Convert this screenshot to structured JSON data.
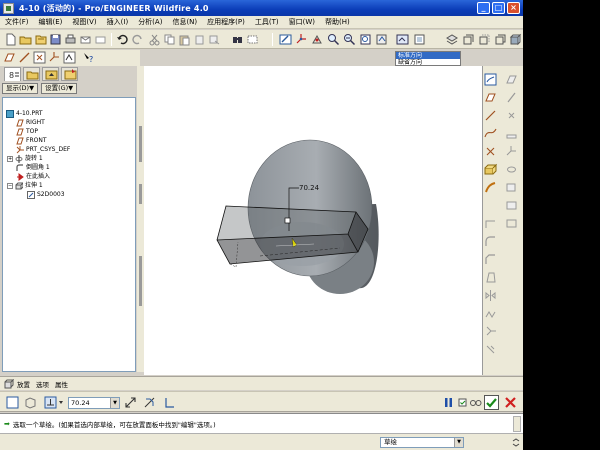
{
  "window": {
    "title": "4-10 (活动的) - Pro/ENGINEER Wildfire 4.0",
    "controls": [
      "_",
      "□",
      "×"
    ]
  },
  "menu": [
    "文件(F)",
    "编辑(E)",
    "视图(V)",
    "插入(I)",
    "分析(A)",
    "信息(N)",
    "应用程序(P)",
    "工具(T)",
    "窗口(W)",
    "帮助(H)"
  ],
  "view_dropdown": {
    "options": [
      "标准方向",
      "缺省方向"
    ],
    "selected": "标准方向"
  },
  "sidebar": {
    "display_btn": "显示(D)▼",
    "settings_btn": "设置(G)▼",
    "tree": [
      {
        "label": "4-10.PRT",
        "icon": "part-icon"
      },
      {
        "label": "RIGHT",
        "icon": "datum-plane-icon"
      },
      {
        "label": "TOP",
        "icon": "datum-plane-icon"
      },
      {
        "label": "FRONT",
        "icon": "datum-plane-icon"
      },
      {
        "label": "PRT_CSYS_DEF",
        "icon": "csys-icon"
      },
      {
        "label": "旋转 1",
        "icon": "revolve-icon"
      },
      {
        "label": "倒圆角 1",
        "icon": "round-icon"
      },
      {
        "label": "在此插入",
        "icon": "insert-arrow-icon"
      },
      {
        "label": "拉伸 1",
        "icon": "extrude-icon"
      },
      {
        "label": "S2D0003",
        "icon": "sketch-icon"
      }
    ]
  },
  "viewport": {
    "dimension_label": "70.24"
  },
  "dashboard": {
    "tabs": [
      "放置",
      "选项",
      "属性"
    ],
    "depth_value": "70.24",
    "depth_arrow": "▼"
  },
  "message": {
    "text": "选取一个草绘。(如果首选内部草绘，可在放置面板中找到\"编辑\"选项。)"
  },
  "status": {
    "filter": "草绘",
    "filter_arrow": "▼"
  },
  "colors": {
    "title_bar": "#0b3db8",
    "accept": "#1a8a1a",
    "cancel": "#d02020",
    "pause": "#1f4fa8",
    "body": "#9da2a8"
  }
}
